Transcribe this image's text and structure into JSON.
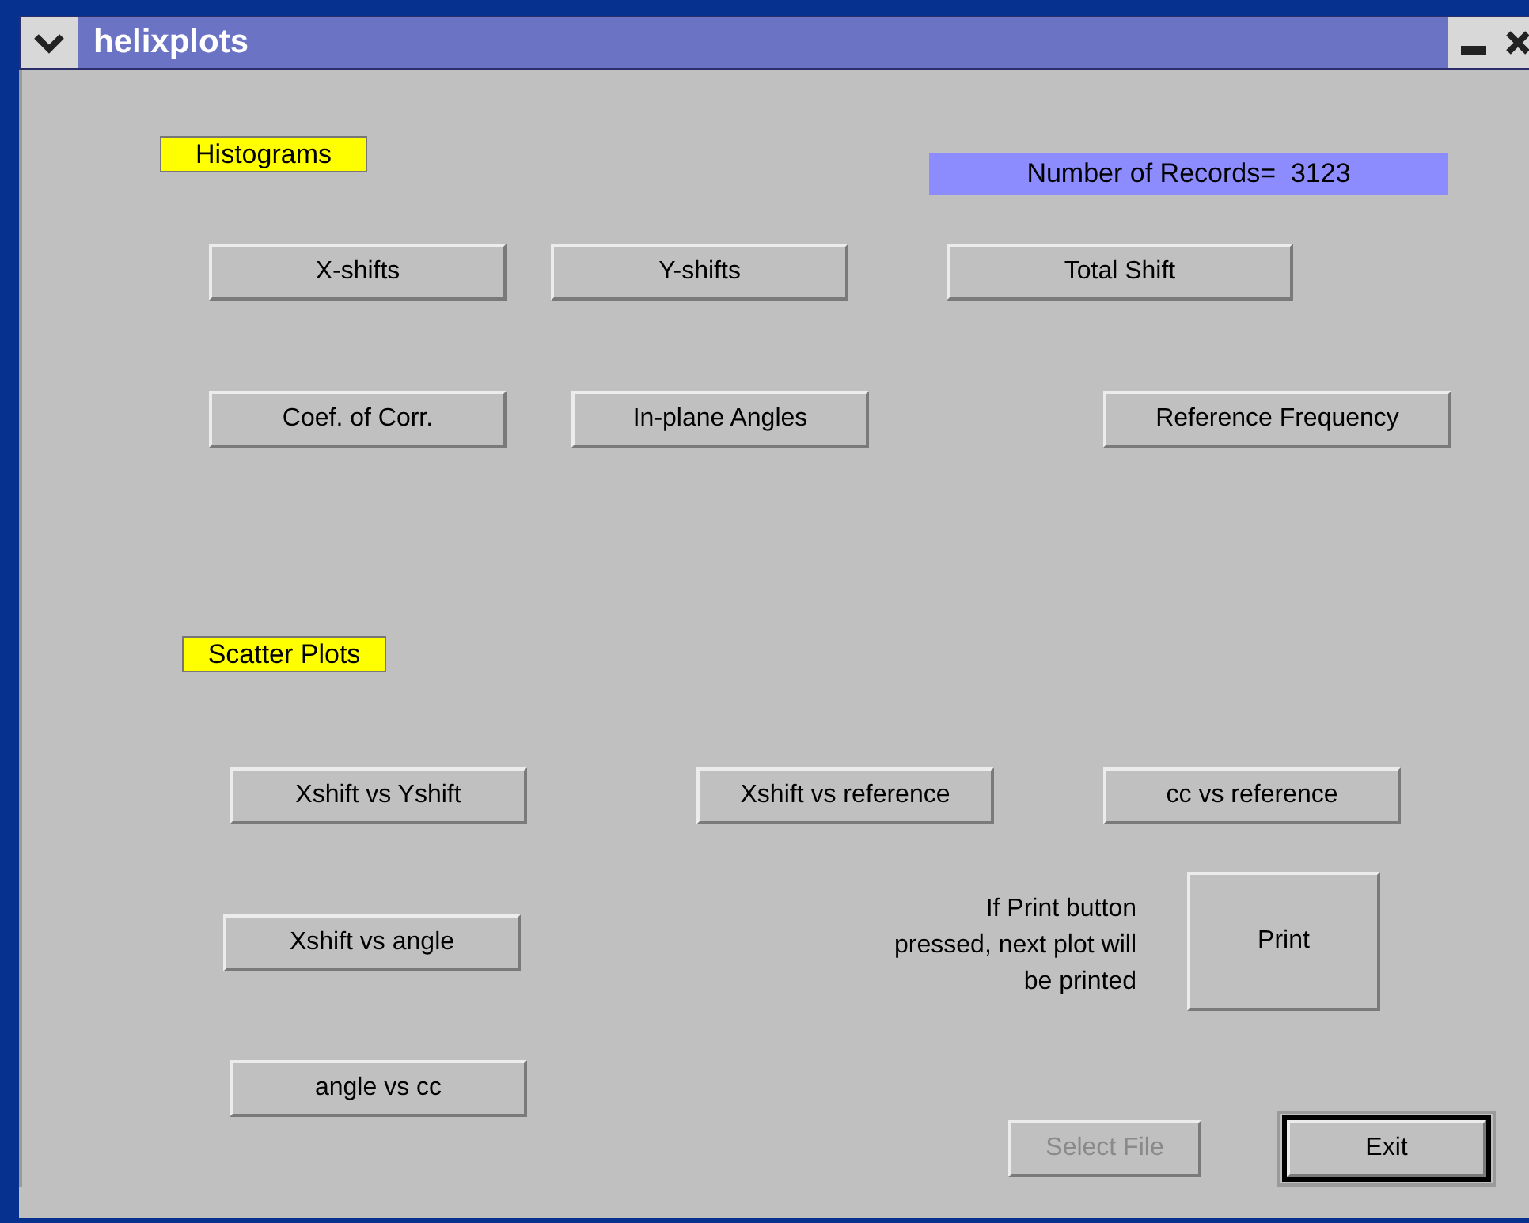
{
  "window": {
    "title": "helixplots"
  },
  "histograms": {
    "label": "Histograms",
    "records": "Number of Records=  3123",
    "buttons": [
      {
        "label": "X-shifts"
      },
      {
        "label": "Y-shifts"
      },
      {
        "label": "Total Shift"
      },
      {
        "label": "Coef. of Corr."
      },
      {
        "label": "In-plane Angles"
      },
      {
        "label": "Reference Frequency"
      }
    ]
  },
  "scatter": {
    "label": "Scatter Plots",
    "buttons": [
      {
        "label": "Xshift vs Yshift"
      },
      {
        "label": "Xshift vs reference"
      },
      {
        "label": "cc vs reference"
      },
      {
        "label": "Xshift vs angle"
      },
      {
        "label": "angle vs cc"
      }
    ]
  },
  "print_note": "If Print button pressed, next plot will be printed",
  "print_button": "Print",
  "bottom_buttons": [
    {
      "label": "Select File",
      "disabled": true,
      "default": false
    },
    {
      "label": "Exit",
      "disabled": false,
      "default": true
    }
  ]
}
